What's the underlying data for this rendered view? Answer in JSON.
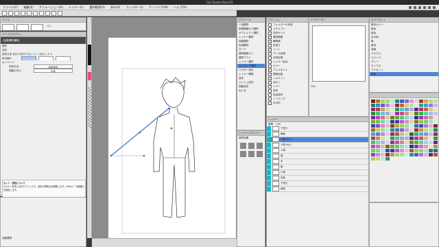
{
  "window": {
    "title": "Clip Studio Paint EX"
  },
  "menu": [
    "ファイル(F)",
    "編集(E)",
    "アニメーション(A)",
    "レイヤー(L)",
    "選択範囲(S)",
    "表示(V)",
    "フィルター(I)",
    "ウィンドウ(W)",
    "ヘルプ(H)"
  ],
  "tool_panel": {
    "title": "ツール",
    "sub": "ペン"
  },
  "property_panel": {
    "title": "ツールプロパティ",
    "header": "[自動選択補助]",
    "rows": [
      {
        "label": "操作",
        "value": ""
      },
      {
        "label": "変形",
        "value": ""
      },
      {
        "label": "変形方法",
        "value": "変形の操作方法について設定します。"
      },
      {
        "label": "拡大縮小",
        "value": ""
      },
      {
        "label": "キーワード",
        "value": ""
      }
    ],
    "mode_label": "変形方法",
    "mode_value": "自由変形",
    "center_label": "回転の中心",
    "center_value": "中央"
  },
  "help_box": {
    "title": "カット・変形について",
    "text": "Ctrlキーを押しながらドラッグで、変形の基準点を移動します。Shiftキーで縦横比を固定します。"
  },
  "bottom_left": {
    "label": "自動選択"
  },
  "subtool_list": {
    "title": "サブツール",
    "items": [
      "一括選択",
      "参照範囲から選択",
      "オブジェクト選択",
      "レイヤー選択",
      "自動選択",
      "色域選択",
      "ロープ",
      "選択範囲ペン",
      "選択ブラシ",
      "レイヤー選択",
      "シュリンク選択",
      "ベクター消去",
      "レイヤー移動",
      "変形",
      "メッシュ変形",
      "回転変形",
      "ねじる"
    ]
  },
  "layer_prop": {
    "title": "レイヤープロパティ",
    "sub": "境界効果"
  },
  "checklist": {
    "title": "アクション",
    "items": [
      "フォルダーの作成",
      "スクリプト",
      "変形ガイド",
      "選択範囲",
      "輪郭線",
      "色塗り",
      "トーン",
      "パース定規",
      "対称定規",
      "レイヤー結合",
      "カラー",
      "アシスタント",
      "鏡像反転",
      "シルエット",
      "ぼかし",
      "ヘアー",
      "変形",
      "自由変形",
      "トリミング",
      "手の形"
    ]
  },
  "navigator": {
    "title": "ナビゲーター",
    "zoom": "100"
  },
  "color_set": {
    "title": "カラーセット",
    "sets": [
      "基本カラー",
      "肌色",
      "髪色",
      "目の色",
      "服",
      "影色",
      "背景",
      "パステル",
      "ビビッド",
      "グレー",
      "モノクロ",
      "アクセント",
      "和色"
    ]
  },
  "layer_panel": {
    "title": "レイヤー",
    "blend": "通常",
    "opacity": "100",
    "layers": [
      "下書き",
      "線画",
      "人物 Vol.1",
      "人物 Vol.2",
      "人物",
      "顔",
      "手",
      "服",
      "小物",
      "背景",
      "下書き",
      "用紙"
    ]
  },
  "colors": {
    "accent": "#00bcd4",
    "selection": "#3d76c0"
  }
}
